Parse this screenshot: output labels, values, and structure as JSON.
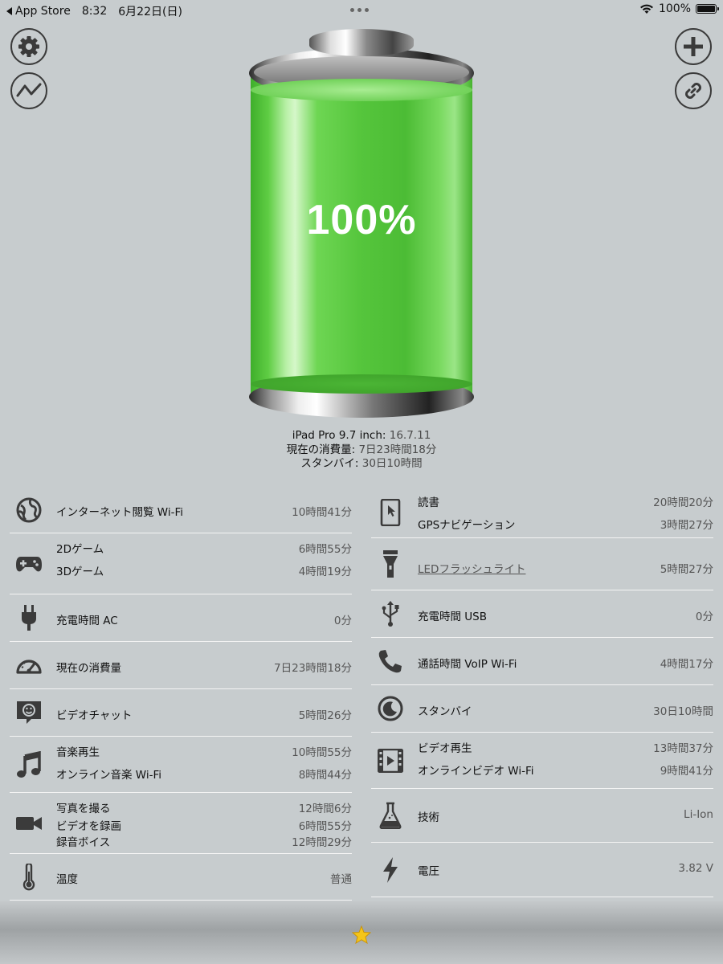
{
  "status_bar": {
    "back_label": "App Store",
    "time": "8:32",
    "date": "6月22日(日)",
    "battery_percent": "100%"
  },
  "battery": {
    "percent_label": "100%",
    "level": 1.0,
    "fill_color": "#55c53c"
  },
  "device": {
    "model_label": "iPad Pro 9.7 inch",
    "model_value": "16.7.11",
    "usage_label": "現在の消費量",
    "usage_value": "7日23時間18分",
    "standby_label": "スタンバイ",
    "standby_value": "30日10時間"
  },
  "left_items": [
    {
      "icon": "globe-icon",
      "lines": [
        {
          "label": "インターネット閲覧 Wi-Fi",
          "value": "10時間41分"
        }
      ]
    },
    {
      "icon": "gamepad-icon",
      "lines": [
        {
          "label": "2Dゲーム",
          "value": "6時間55分"
        },
        {
          "label": "3Dゲーム",
          "value": "4時間19分"
        }
      ]
    },
    {
      "icon": "plug-icon",
      "lines": [
        {
          "label": "充電時間 AC",
          "value": "0分"
        }
      ]
    },
    {
      "icon": "speedometer-icon",
      "lines": [
        {
          "label": "現在の消費量",
          "value": "7日23時間18分"
        }
      ]
    },
    {
      "icon": "video-chat-icon",
      "lines": [
        {
          "label": "ビデオチャット",
          "value": "5時間26分"
        }
      ]
    },
    {
      "icon": "music-note-icon",
      "lines": [
        {
          "label": "音楽再生",
          "value": "10時間55分"
        },
        {
          "label": "オンライン音楽 Wi-Fi",
          "value": "8時間44分"
        }
      ]
    },
    {
      "icon": "video-camera-icon",
      "lines": [
        {
          "label": "写真を撮る",
          "value": "12時間6分"
        },
        {
          "label": "ビデオを録画",
          "value": "6時間55分"
        },
        {
          "label": "録音ボイス",
          "value": "12時間29分"
        }
      ]
    },
    {
      "icon": "thermometer-icon",
      "lines": [
        {
          "label": "温度",
          "value": "普通"
        }
      ]
    }
  ],
  "right_items": [
    {
      "icon": "tablet-touch-icon",
      "lines": [
        {
          "label": "読書",
          "value": "20時間20分"
        },
        {
          "label": "GPSナビゲーション",
          "value": "3時間27分"
        }
      ]
    },
    {
      "icon": "flashlight-icon",
      "lines": [
        {
          "label": "LEDフラッシュライト",
          "value": "5時間27分"
        }
      ]
    },
    {
      "icon": "usb-icon",
      "lines": [
        {
          "label": "充電時間 USB",
          "value": "0分"
        }
      ]
    },
    {
      "icon": "phone-icon",
      "lines": [
        {
          "label": "通話時間 VoIP Wi-Fi",
          "value": "4時間17分"
        }
      ]
    },
    {
      "icon": "moon-icon",
      "lines": [
        {
          "label": "スタンバイ",
          "value": "30日10時間"
        }
      ]
    },
    {
      "icon": "film-play-icon",
      "lines": [
        {
          "label": "ビデオ再生",
          "value": "13時間37分"
        },
        {
          "label": "オンラインビデオ Wi-Fi",
          "value": "9時間41分"
        }
      ]
    },
    {
      "icon": "flask-icon",
      "lines": [
        {
          "label": "技術",
          "value": "Li-Ion"
        }
      ]
    },
    {
      "icon": "lightning-icon",
      "lines": [
        {
          "label": "電圧",
          "value": "3.82 V"
        }
      ]
    }
  ],
  "colors": {
    "background": "#c7ccce",
    "battery_green": "#55c53c",
    "icon_dark": "#3b3b3b",
    "star": "#f5c518"
  }
}
